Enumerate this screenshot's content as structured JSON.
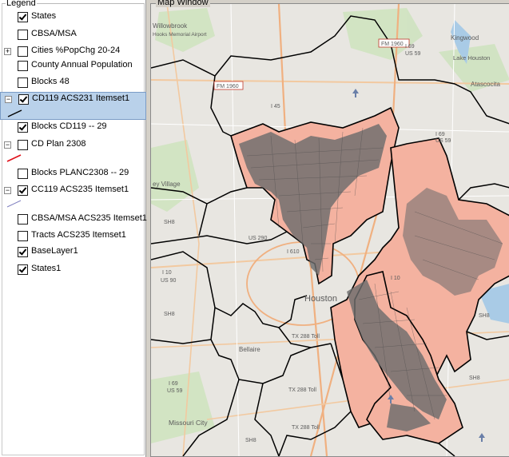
{
  "legend": {
    "title": "Legend",
    "layers": [
      {
        "label": "States",
        "checked": true
      },
      {
        "label": "CBSA/MSA",
        "checked": false
      },
      {
        "label": "Cities %PopChg 20-24",
        "checked": false,
        "expander": "+"
      },
      {
        "label": "County Annual Population",
        "checked": false
      },
      {
        "label": "Blocks 48",
        "checked": false
      },
      {
        "label": "CD119 ACS231 Itemset1",
        "checked": true,
        "expander": "−",
        "selected": true
      },
      {
        "label": "Blocks CD119 -- 29",
        "checked": true
      },
      {
        "label": "CD Plan 2308",
        "checked": false,
        "expander": "−"
      },
      {
        "label": "Blocks PLANC2308 -- 29",
        "checked": false
      },
      {
        "label": "CC119 ACS235 Itemset1",
        "checked": true,
        "expander": "−"
      },
      {
        "label": "CBSA/MSA ACS235 Itemset1",
        "checked": false
      },
      {
        "label": "Tracts ACS235 Itemset1",
        "checked": false
      },
      {
        "label": "BaseLayer1",
        "checked": true
      },
      {
        "label": "States1",
        "checked": true
      }
    ],
    "swatch_colors": {
      "cd119": "#000000",
      "cd_plan": "#e0101a",
      "cc119": "#8080c0"
    }
  },
  "map": {
    "title": "Map Window",
    "colors": {
      "base": "#e8e6e1",
      "district_fill": "#f4b2a0",
      "blocks_dark": "#6d6d6d",
      "boundary": "#000000"
    },
    "place_labels": {
      "willowbrook": "Willowbrook",
      "willowbrook_note": "Hooks Memorial Airport",
      "kingwood": "Kingwood",
      "lake_houston": "Lake Houston",
      "atascocita": "Atascocita",
      "houston": "Houston",
      "bellaire": "Bellaire",
      "missouri_city": "Missouri City",
      "village": "ey Village"
    },
    "road_labels": {
      "fm1960a": "FM 1960",
      "fm1960b": "FM 1960",
      "i45": "I 45",
      "i69a": "I 69",
      "us59a": "US 59",
      "i69b": "I 69",
      "us59b": "US 59",
      "us290": "US 290",
      "i610": "I 610",
      "i10a": "I 10",
      "us90a": "US 90",
      "i10b": "I 10",
      "i69c": "I 69",
      "us59c": "US 59",
      "tx288a": "TX 288 Toll",
      "tx288b": "TX 288 Toll",
      "tx288c": "TX 288 Toll",
      "sh8a": "SH8",
      "sh8b": "SH8",
      "sh8c": "SH8",
      "sh8d": "SH8",
      "sh8e": "SH8"
    }
  }
}
